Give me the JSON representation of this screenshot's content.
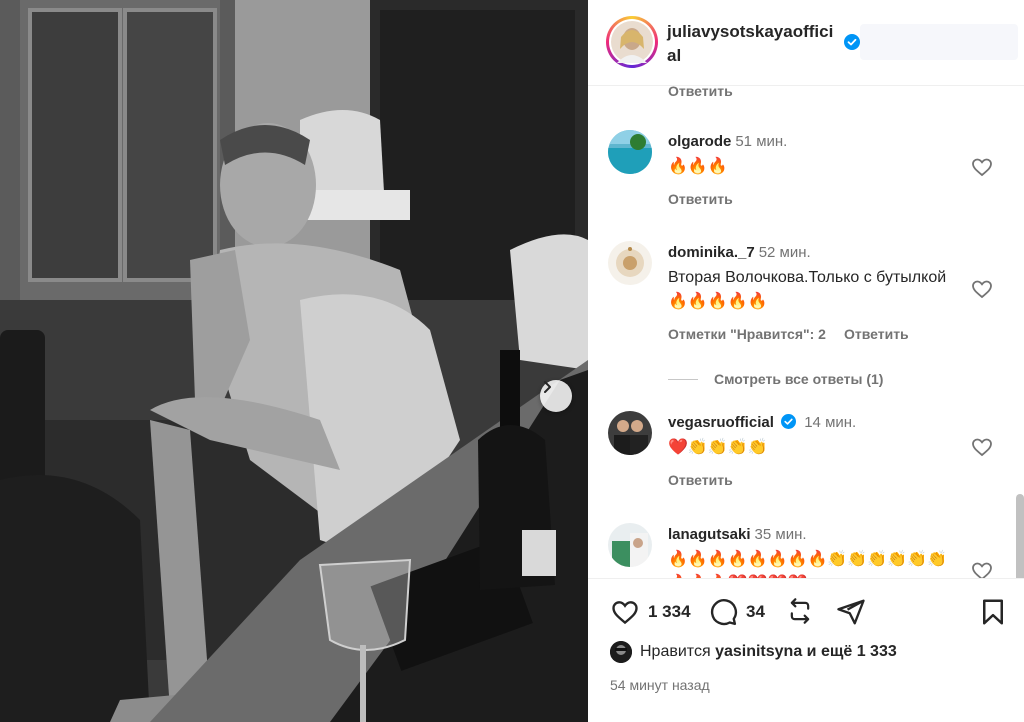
{
  "post": {
    "username": "juliavysotskayaofficial",
    "verified": true
  },
  "comments_section": {
    "top_reply_label": "Ответить",
    "comments": [
      {
        "user": "olgarode",
        "time": "51 мин.",
        "text": "🔥🔥🔥",
        "reply_label": "Ответить"
      },
      {
        "user": "dominika._7",
        "time": "52 мин.",
        "text": "Вторая Волочкова.Только с бутылкой 🔥🔥🔥🔥🔥",
        "likes_label": "Отметки \"Нравится\": 2",
        "reply_label": "Ответить",
        "view_replies": "Смотреть все ответы (1)"
      },
      {
        "user": "vegasruofficial",
        "verified": true,
        "time": "14 мин.",
        "text": "❤️👏👏👏👏",
        "reply_label": "Ответить"
      },
      {
        "user": "lanagutsaki",
        "time": "35 мин.",
        "text": "🔥🔥🔥🔥🔥🔥🔥🔥👏👏👏👏👏👏 🔥🔥🔥❤️❤️❤️❤️"
      }
    ]
  },
  "actions": {
    "likes_count": "1 334",
    "comments_count": "34"
  },
  "likes_summary": {
    "prefix": "Нравится",
    "user": "yasinitsyna",
    "suffix": "и ещё 1 333"
  },
  "post_time": "54 минут назад",
  "colors": {
    "text": "#262626",
    "secondary": "#737373",
    "verified": "#0095f6",
    "border": "#efefef"
  },
  "icons": [
    "chevron-right-icon",
    "verified-icon",
    "heart-icon",
    "comment-icon",
    "repost-icon",
    "share-icon",
    "bookmark-icon"
  ]
}
